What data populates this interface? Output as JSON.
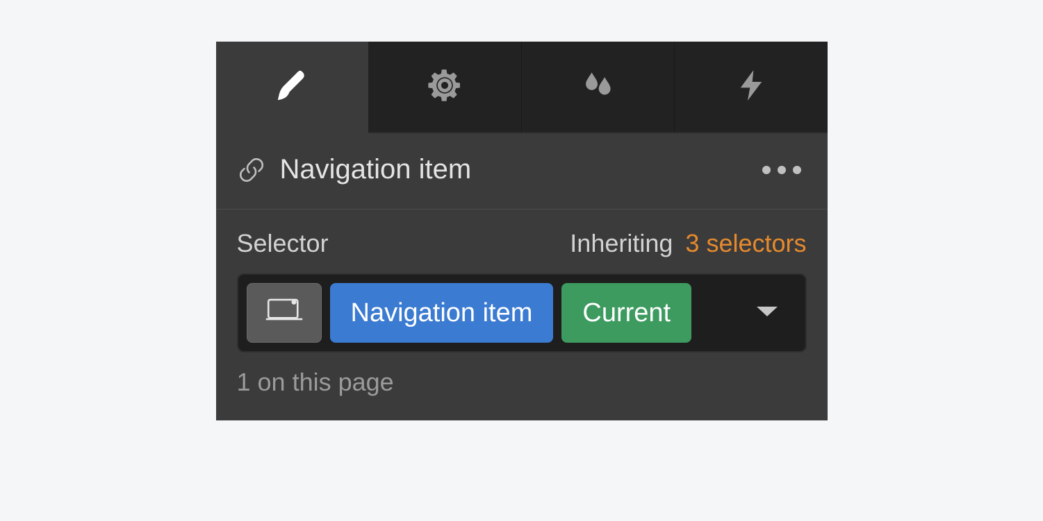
{
  "element": {
    "label": "Navigation item"
  },
  "tabs": {
    "style_icon": "brush-icon",
    "settings_icon": "gear-icon",
    "effects_icon": "droplets-icon",
    "interactions_icon": "bolt-icon",
    "active_index": 0
  },
  "selector": {
    "heading_label": "Selector",
    "inheriting_label": "Inheriting",
    "inheriting_count_label": "3 selectors",
    "class_tag": "Navigation item",
    "state_tag": "Current",
    "count_line": "1 on this page"
  },
  "colors": {
    "class_chip": "#3b7bd1",
    "state_chip": "#3e9b60",
    "inherit_link": "#e68a2d",
    "panel_bg": "#3b3b3b",
    "tab_inactive_bg": "#222222",
    "selector_box_bg": "#1e1e1e"
  }
}
